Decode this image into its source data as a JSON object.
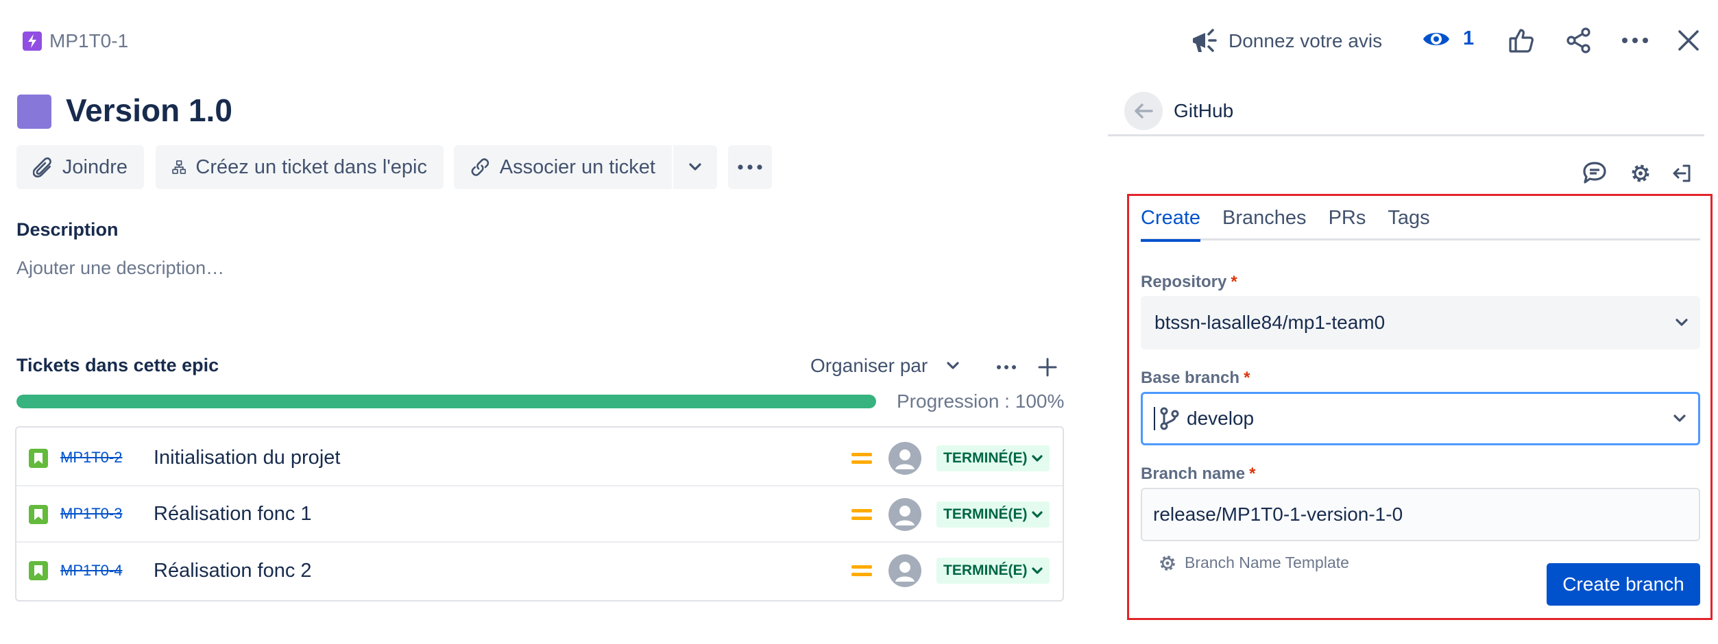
{
  "header": {
    "issue_key": "MP1T0-1",
    "feedback_label": "Donnez votre avis",
    "watch_count": "1"
  },
  "issue": {
    "title": "Version 1.0"
  },
  "actions": {
    "attach": "Joindre",
    "create_child": "Créez un ticket dans l'epic",
    "link_issue": "Associer un ticket"
  },
  "description": {
    "heading": "Description",
    "placeholder": "Ajouter une description…"
  },
  "epic_tickets": {
    "heading": "Tickets dans cette epic",
    "sort_label": "Organiser par",
    "progress_label": "Progression : 100%",
    "progress_value": 1.0,
    "rows": [
      {
        "key": "MP1T0-2",
        "summary": "Initialisation du projet",
        "status": "TERMINÉ(E)"
      },
      {
        "key": "MP1T0-3",
        "summary": "Réalisation fonc 1",
        "status": "TERMINÉ(E)"
      },
      {
        "key": "MP1T0-4",
        "summary": "Réalisation fonc 2",
        "status": "TERMINÉ(E)"
      }
    ]
  },
  "github_panel": {
    "title": "GitHub",
    "tabs": [
      "Create",
      "Branches",
      "PRs",
      "Tags"
    ],
    "active_tab": "Create",
    "repository_label": "Repository",
    "repository_value": "btssn-lasalle84/mp1-team0",
    "base_branch_label": "Base branch",
    "base_branch_value": "develop",
    "branch_name_label": "Branch name",
    "branch_name_value": "release/MP1T0-1-version-1-0",
    "template_link": "Branch Name Template",
    "create_button": "Create branch",
    "required_marker": "*"
  },
  "colors": {
    "accent": "#0052cc",
    "epic": "#8777d9",
    "progress": "#36b37e",
    "done_bg": "#e3fcef",
    "done_text": "#006644",
    "priority": "#ffab00",
    "highlight_border": "#e3242b"
  }
}
